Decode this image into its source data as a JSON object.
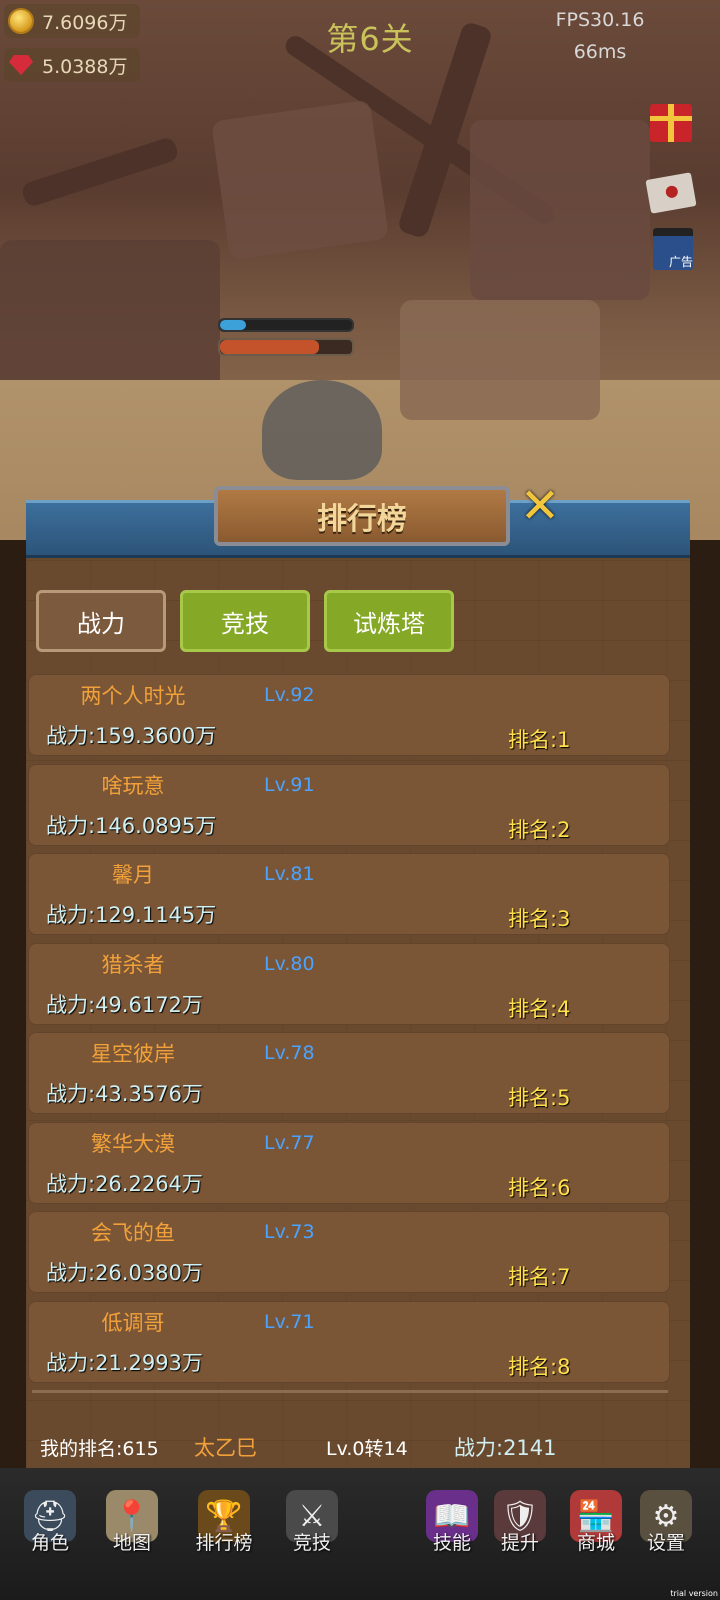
{
  "hud": {
    "gold": "7.6096万",
    "gems": "5.0388万",
    "level": "第6关",
    "fps": "FPS30.16",
    "latency": "66ms",
    "gold_icon": "coin-icon",
    "gem_icon": "gem-icon"
  },
  "side_icons": [
    "gift-icon",
    "mail-icon",
    "video-ad-icon"
  ],
  "video_ad_label": "广告",
  "enemy": {
    "shield_fraction": 0.2,
    "hp_fraction": 0.75
  },
  "panel": {
    "title": "排行榜",
    "close_icon": "close-icon",
    "tabs": [
      {
        "label": "战力",
        "state": "selected"
      },
      {
        "label": "竞技",
        "state": "normal"
      },
      {
        "label": "试炼塔",
        "state": "normal"
      }
    ],
    "rows": [
      {
        "name": "两个人时光",
        "level": "Lv.92",
        "power": "战力:159.3600万",
        "rank": "排名:1"
      },
      {
        "name": "啥玩意",
        "level": "Lv.91",
        "power": "战力:146.0895万",
        "rank": "排名:2"
      },
      {
        "name": "馨月",
        "level": "Lv.81",
        "power": "战力:129.1145万",
        "rank": "排名:3"
      },
      {
        "name": "猎杀者",
        "level": "Lv.80",
        "power": "战力:49.6172万",
        "rank": "排名:4"
      },
      {
        "name": "星空彼岸",
        "level": "Lv.78",
        "power": "战力:43.3576万",
        "rank": "排名:5"
      },
      {
        "name": "繁华大漠",
        "level": "Lv.77",
        "power": "战力:26.2264万",
        "rank": "排名:6"
      },
      {
        "name": "会飞的鱼",
        "level": "Lv.73",
        "power": "战力:26.0380万",
        "rank": "排名:7"
      },
      {
        "name": "低调哥",
        "level": "Lv.71",
        "power": "战力:21.2993万",
        "rank": "排名:8"
      }
    ],
    "me": {
      "rank": "我的排名:615",
      "name": "太乙巳",
      "level": "Lv.0转14",
      "power": "战力:2141"
    }
  },
  "nav": [
    {
      "label": "角色",
      "icon": "helmet-icon"
    },
    {
      "label": "地图",
      "icon": "map-icon"
    },
    {
      "label": "排行榜",
      "icon": "trophy-icon"
    },
    {
      "label": "竞技",
      "icon": "crossed-swords-icon"
    },
    {
      "label": "技能",
      "icon": "skill-book-icon"
    },
    {
      "label": "提升",
      "icon": "armor-icon"
    },
    {
      "label": "商城",
      "icon": "shop-icon"
    },
    {
      "label": "设置",
      "icon": "gear-icon"
    }
  ],
  "watermark": "trial version",
  "colors": {
    "tab_selected": "#7c5a3e",
    "tab_normal": "#86a827",
    "player_name": "#f2a13a",
    "level_text": "#4aa3ff",
    "rank_text": "#ffe04a"
  }
}
